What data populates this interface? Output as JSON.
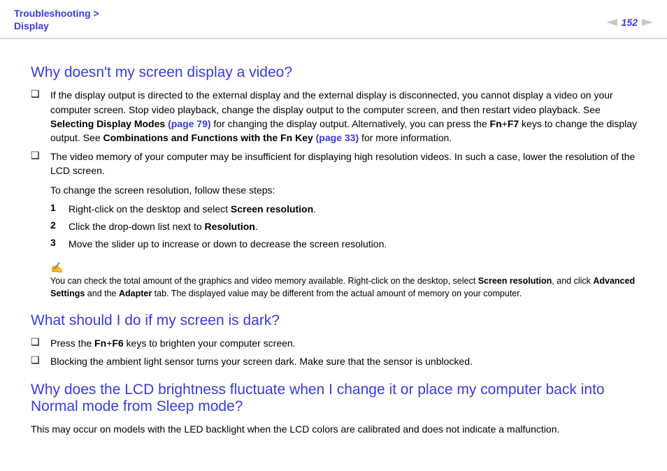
{
  "header": {
    "breadcrumb_line1": "Troubleshooting >",
    "breadcrumb_line2": "Display",
    "page_number": "152"
  },
  "q1": {
    "title": "Why doesn't my screen display a video?",
    "b1_pre": "If the display output is directed to the external display and the external display is disconnected, you cannot display a video on your computer screen. Stop video playback, change the display output to the computer screen, and then restart video playback. See ",
    "b1_link1_text": "Selecting Display Modes ",
    "b1_link1_page": "(page 79)",
    "b1_mid1": " for changing the display output. Alternatively, you can press the ",
    "b1_fn": "Fn",
    "b1_plus": "+",
    "b1_f7": "F7",
    "b1_mid2": " keys to change the display output. See ",
    "b1_link2_text": "Combinations and Functions with the Fn Key ",
    "b1_link2_page": "(page 33)",
    "b1_end": " for more information.",
    "b2": "The video memory of your computer may be insufficient for displaying high resolution videos. In such a case, lower the resolution of the LCD screen.",
    "sub": "To change the screen resolution, follow these steps:",
    "s1_pre": "Right-click on the desktop and select ",
    "s1_bold": "Screen resolution",
    "s1_post": ".",
    "s2_pre": "Click the drop-down list next to ",
    "s2_bold": "Resolution",
    "s2_post": ".",
    "s3": "Move the slider up to increase or down to decrease the screen resolution.",
    "note_icon": "✍",
    "note_pre": "You can check the total amount of the graphics and video memory available. Right-click on the desktop, select ",
    "note_b1": "Screen resolution",
    "note_mid1": ", and click ",
    "note_b2": "Advanced Settings",
    "note_mid2": " and the ",
    "note_b3": "Adapter",
    "note_end": " tab. The displayed value may be different from the actual amount of memory on your computer."
  },
  "q2": {
    "title": "What should I do if my screen is dark?",
    "b1_pre": "Press the ",
    "b1_fn": "Fn",
    "b1_plus": "+",
    "b1_f6": "F6",
    "b1_post": " keys to brighten your computer screen.",
    "b2": "Blocking the ambient light sensor turns your screen dark. Make sure that the sensor is unblocked."
  },
  "q3": {
    "title": "Why does the LCD brightness fluctuate when I change it or place my computer back into Normal mode from Sleep mode?",
    "body": "This may occur on models with the LED backlight when the LCD colors are calibrated and does not indicate a malfunction."
  }
}
